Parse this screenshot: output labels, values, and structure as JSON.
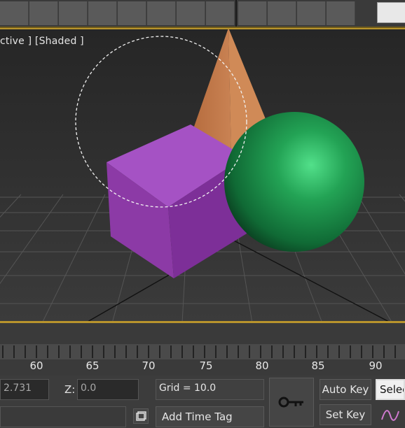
{
  "viewport": {
    "label": "ctive ] [Shaded ]"
  },
  "timeline": {
    "frame_labels": [
      "60",
      "65",
      "70",
      "75",
      "80",
      "85",
      "90"
    ]
  },
  "status": {
    "x_value": "2.731",
    "z_label": "Z:",
    "z_value": "0.0",
    "grid_text": "Grid = 10.0",
    "add_time_tag": "Add Time Tag",
    "auto_key": "Auto Key",
    "set_key": "Set Key",
    "selected_field": "Selec"
  },
  "colors": {
    "viewport_border": "#b8942c",
    "cube": "#9b45b8",
    "sphere": "#1f8a45",
    "pyramid": "#c07a45"
  },
  "icons": {
    "key": "key-icon",
    "lock": "lock-selection-icon",
    "curve": "key-filter-curve-icon"
  }
}
